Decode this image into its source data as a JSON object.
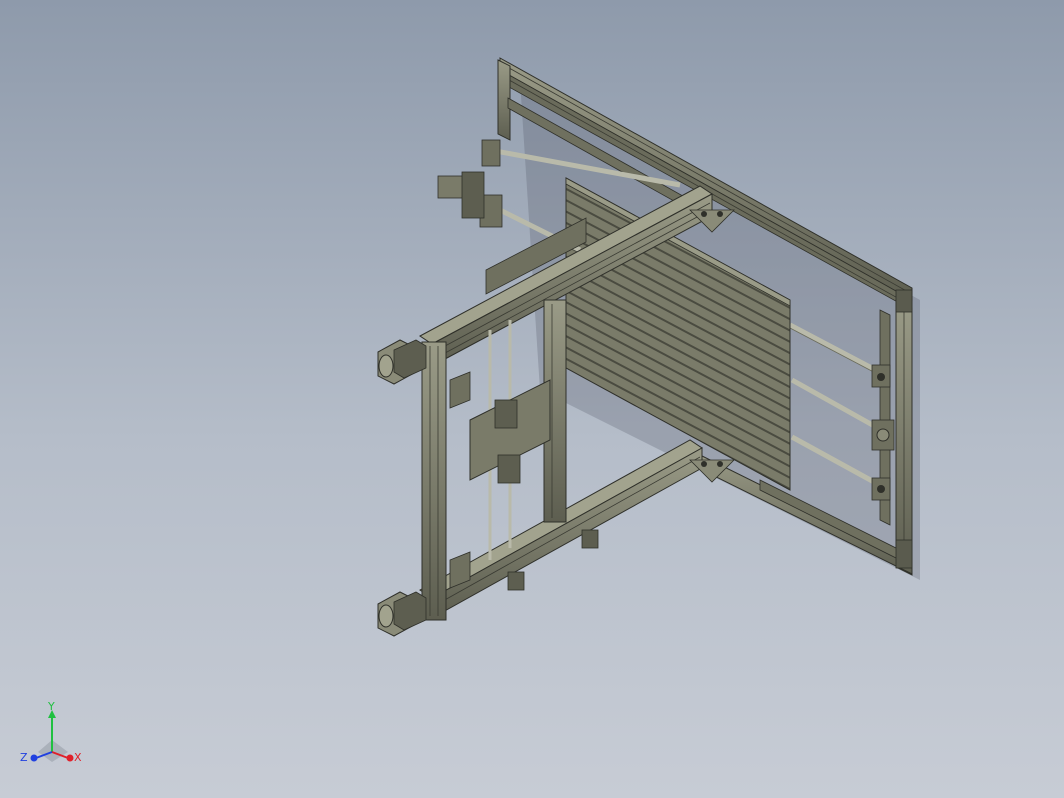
{
  "viewport": {
    "background_top": "#8e9aab",
    "background_bottom": "#c7ccd5"
  },
  "model": {
    "profile_color": "#7d7e6b",
    "profile_dark": "#3e3f36",
    "rod_color": "#b9baaa"
  },
  "triad": {
    "x_label": "X",
    "y_label": "Y",
    "z_label": "Z",
    "x_color": "#e0202a",
    "y_color": "#20c040",
    "z_color": "#2040e0"
  }
}
